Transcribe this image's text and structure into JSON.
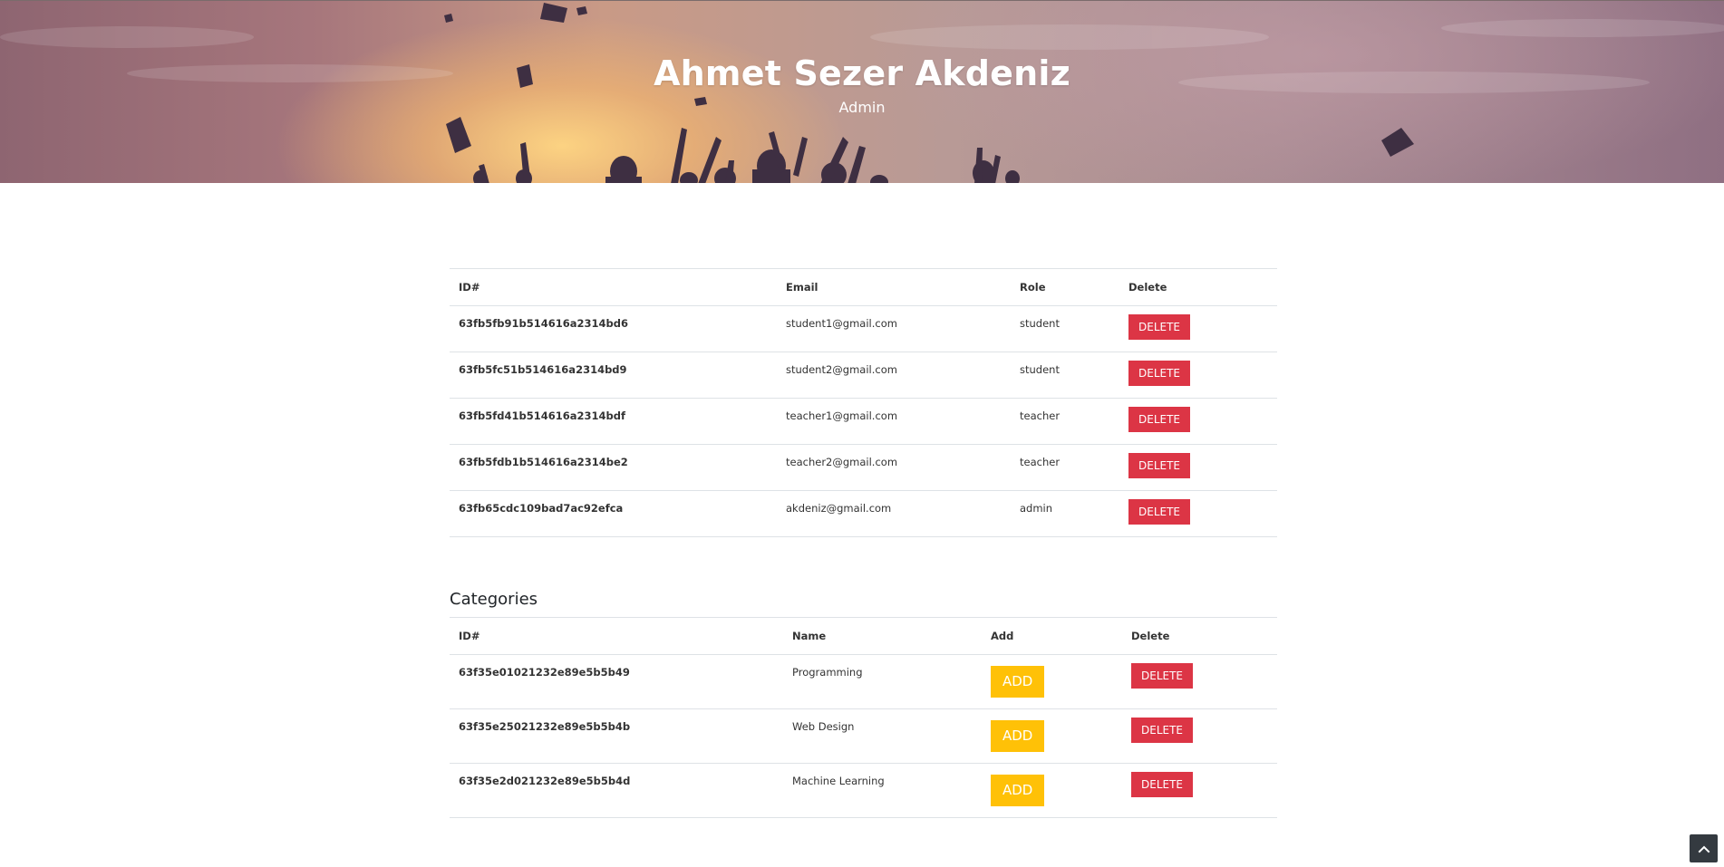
{
  "hero": {
    "title": "Ahmet Sezer Akdeniz",
    "subtitle": "Admin"
  },
  "users": {
    "headers": {
      "id": "ID#",
      "email": "Email",
      "role": "Role",
      "delete": "Delete"
    },
    "rows": [
      {
        "id": "63fb5fb91b514616a2314bd6",
        "email": "student1@gmail.com",
        "role": "student",
        "delete_label": "DELETE"
      },
      {
        "id": "63fb5fc51b514616a2314bd9",
        "email": "student2@gmail.com",
        "role": "student",
        "delete_label": "DELETE"
      },
      {
        "id": "63fb5fd41b514616a2314bdf",
        "email": "teacher1@gmail.com",
        "role": "teacher",
        "delete_label": "DELETE"
      },
      {
        "id": "63fb5fdb1b514616a2314be2",
        "email": "teacher2@gmail.com",
        "role": "teacher",
        "delete_label": "DELETE"
      },
      {
        "id": "63fb65cdc109bad7ac92efca",
        "email": "akdeniz@gmail.com",
        "role": "admin",
        "delete_label": "DELETE"
      }
    ]
  },
  "categories": {
    "heading": "Categories",
    "headers": {
      "id": "ID#",
      "name": "Name",
      "add": "Add",
      "delete": "Delete"
    },
    "rows": [
      {
        "id": "63f35e01021232e89e5b5b49",
        "name": "Programming",
        "add_label": "ADD",
        "delete_label": "DELETE"
      },
      {
        "id": "63f35e25021232e89e5b5b4b",
        "name": "Web Design",
        "add_label": "ADD",
        "delete_label": "DELETE"
      },
      {
        "id": "63f35e2d021232e89e5b5b4d",
        "name": "Machine Learning",
        "add_label": "ADD",
        "delete_label": "DELETE"
      }
    ]
  },
  "colors": {
    "delete_button": "#dc3545",
    "add_button": "#ffc107",
    "scroll_top_button": "#343a40"
  },
  "icons": {
    "scroll_top": "chevron-up-icon"
  }
}
